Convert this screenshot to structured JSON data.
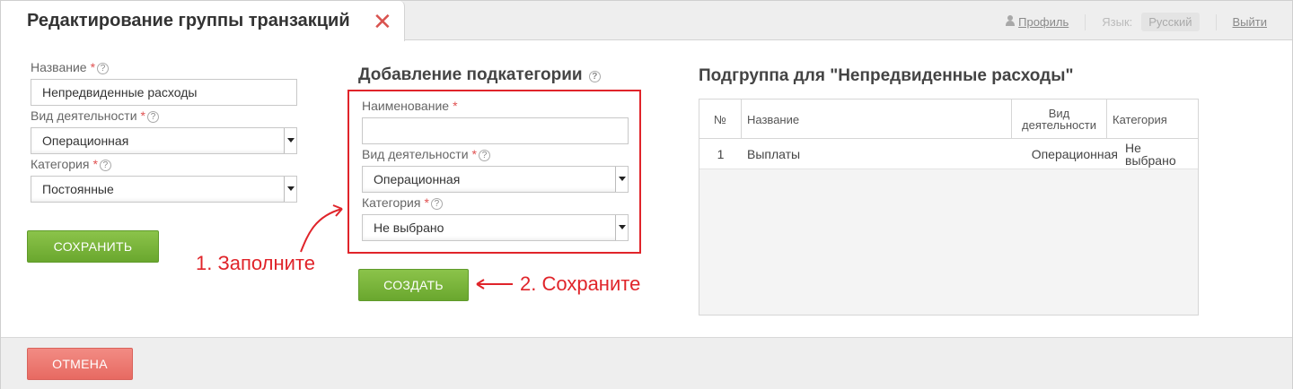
{
  "header": {
    "title": "Редактирование группы транзакций",
    "close_symbol": "✕",
    "profile": "Профиль",
    "language_label": "Язык:",
    "language_value": "Русский",
    "logout": "Выйти"
  },
  "left_form": {
    "name_label": "Название",
    "name_value": "Непредвиденные расходы",
    "activity_label": "Вид деятельности",
    "activity_value": "Операционная",
    "category_label": "Категория",
    "category_value": "Постоянные",
    "save_button": "СОХРАНИТЬ",
    "required_mark": "*",
    "help_mark": "?"
  },
  "subcategory_form": {
    "title": "Добавление подкатегории",
    "name_label": "Наименование",
    "name_value": "",
    "activity_label": "Вид деятельности",
    "activity_value": "Операционная",
    "category_label": "Категория",
    "category_value": "Не выбрано",
    "create_button": "СОЗДАТЬ"
  },
  "annotations": {
    "step1": "1. Заполните",
    "step2": "2. Сохраните",
    "color": "#e0242a"
  },
  "subgroup": {
    "title": "Подгруппа для \"Непредвиденные расходы\"",
    "columns": [
      "№",
      "Название",
      "Вид деятельности",
      "Категория"
    ],
    "rows": [
      {
        "num": "1",
        "name": "Выплаты",
        "activity": "Операционная",
        "category": "Не выбрано"
      }
    ]
  },
  "footer": {
    "cancel_button": "ОТМЕНА"
  }
}
